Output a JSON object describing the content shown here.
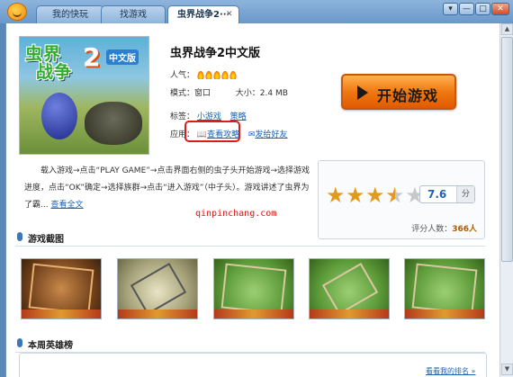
{
  "tabs": [
    {
      "label": "我的快玩"
    },
    {
      "label": "找游戏"
    },
    {
      "label": "虫界战争2···",
      "active": true
    }
  ],
  "window_controls": {
    "menu": "▾",
    "minimize": "—",
    "restore": "□",
    "close": "✕"
  },
  "game": {
    "title": "虫界战争2中文版",
    "cover_title": "虫界",
    "cover_title2": "战争",
    "cover_number": "2",
    "cover_sub": "中文版",
    "popularity_label": "人气：",
    "popularity_flames": 5,
    "mode_label": "模式：",
    "mode_value": "窗口",
    "size_label": "大小：",
    "size_value": "2.4 MB",
    "tags_label": "标签：",
    "tags": [
      "小游戏",
      "策略"
    ],
    "apps_label": "应用：",
    "apps": [
      {
        "label": "查看攻略",
        "icon": "book-icon"
      },
      {
        "label": "发给好友",
        "icon": "share-icon"
      }
    ]
  },
  "start_button": {
    "label": "开始游戏"
  },
  "description": {
    "text": "载入游戏→点击“PLAY GAME”→点击界面右侧的虫子头开始游戏→选择游戏进度，点击“OK”确定→选择族群→点击“进入游戏”（中子头）。游戏讲述了虫界为了霸...",
    "more_link": "查看全文"
  },
  "watermark": "qinpinchang.com",
  "rating": {
    "stars": 3.5,
    "max_stars": 5,
    "score": "7.6",
    "score_unit": "分",
    "count_label": "评分人数：",
    "count": "366人"
  },
  "sections": {
    "screenshots_title": "游戏截图",
    "heroes_title": "本周英雄榜",
    "heroes_link": "看看我的排名 »"
  },
  "screenshots": [
    {
      "alt": "游戏截图1"
    },
    {
      "alt": "游戏截图2"
    },
    {
      "alt": "游戏截图3"
    },
    {
      "alt": "游戏截图4"
    },
    {
      "alt": "游戏截图5"
    }
  ],
  "colors": {
    "accent": "#1c63b6",
    "start_button": "#f07810",
    "highlight": "#d61e1e",
    "star": "#e29a1c"
  }
}
